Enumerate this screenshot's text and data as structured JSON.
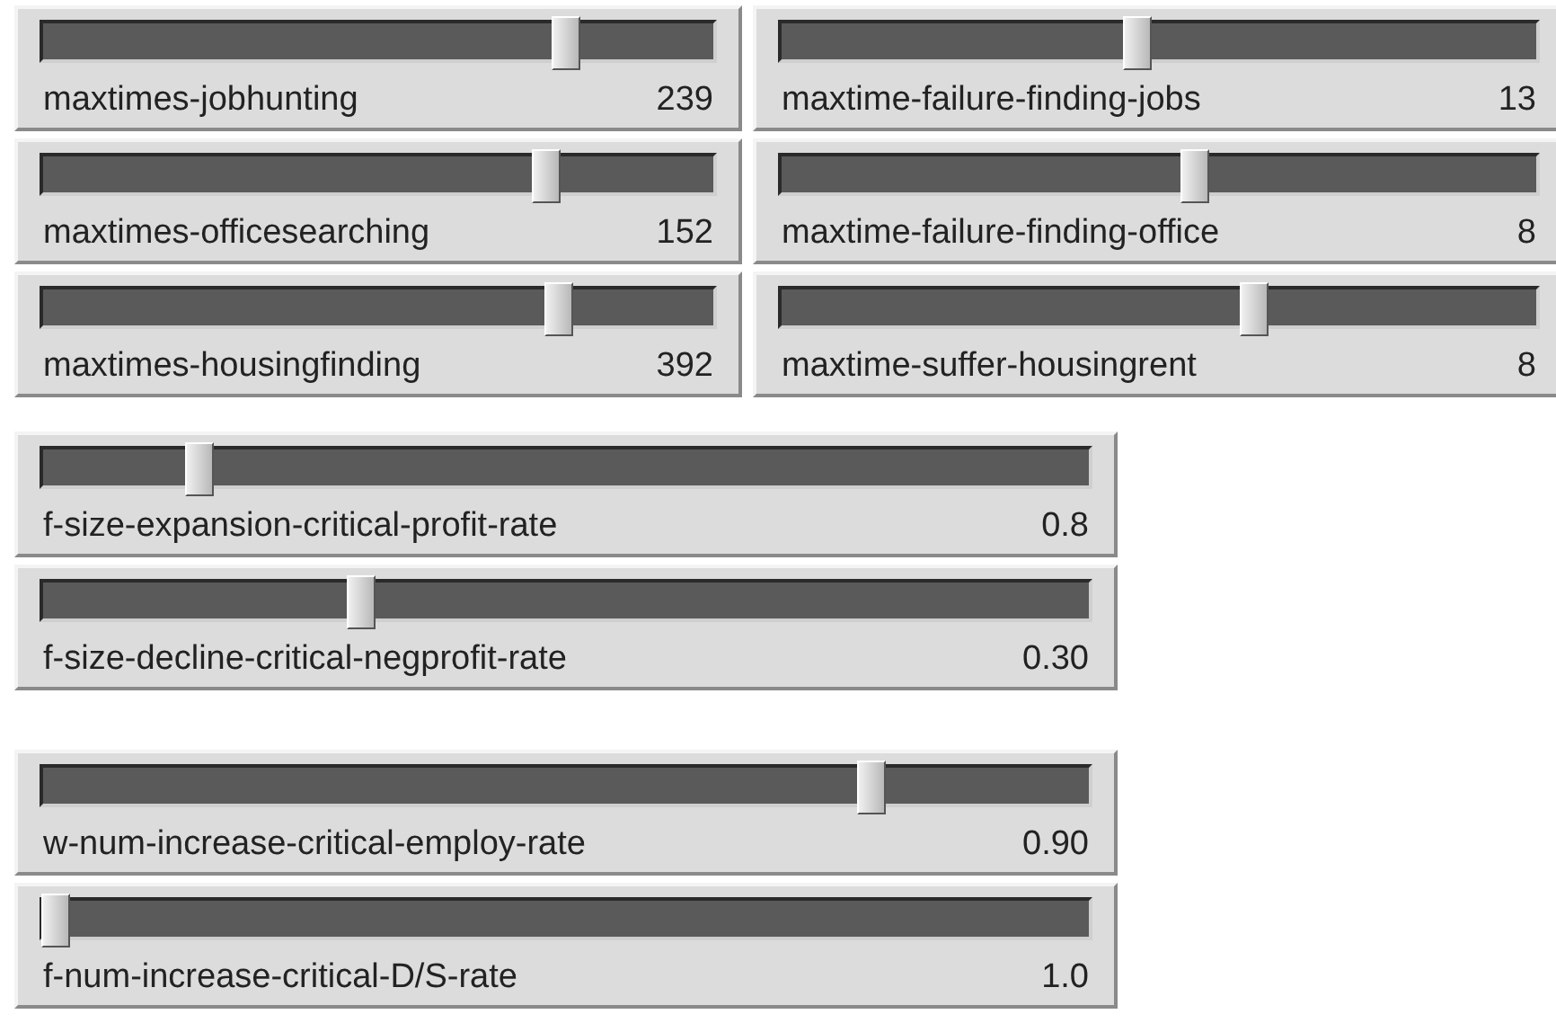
{
  "sections": [
    {
      "kind": "grid",
      "sliders": [
        {
          "label": "maxtimes-jobhunting",
          "value": "239",
          "level": 0.79
        },
        {
          "label": "maxtime-failure-finding-jobs",
          "value": "13",
          "level": 0.47
        },
        {
          "label": "maxtimes-officesearching",
          "value": "152",
          "level": 0.76
        },
        {
          "label": "maxtime-failure-finding-office",
          "value": "8",
          "level": 0.55
        },
        {
          "label": "maxtimes-housingfinding",
          "value": "392",
          "level": 0.78
        },
        {
          "label": "maxtime-suffer-housingrent",
          "value": "8",
          "level": 0.63
        }
      ]
    },
    {
      "kind": "stack",
      "sliders": [
        {
          "label": "f-size-expansion-critical-profit-rate",
          "value": "0.8",
          "level": 0.14
        },
        {
          "label": "f-size-decline-critical-negprofit-rate",
          "value": "0.30",
          "level": 0.3
        }
      ]
    },
    {
      "kind": "stack",
      "sliders": [
        {
          "label": "w-num-increase-critical-employ-rate",
          "value": "0.90",
          "level": 0.8
        },
        {
          "label": "f-num-increase-critical-D/S-rate",
          "value": "1.0",
          "level": 0.0
        }
      ]
    }
  ]
}
